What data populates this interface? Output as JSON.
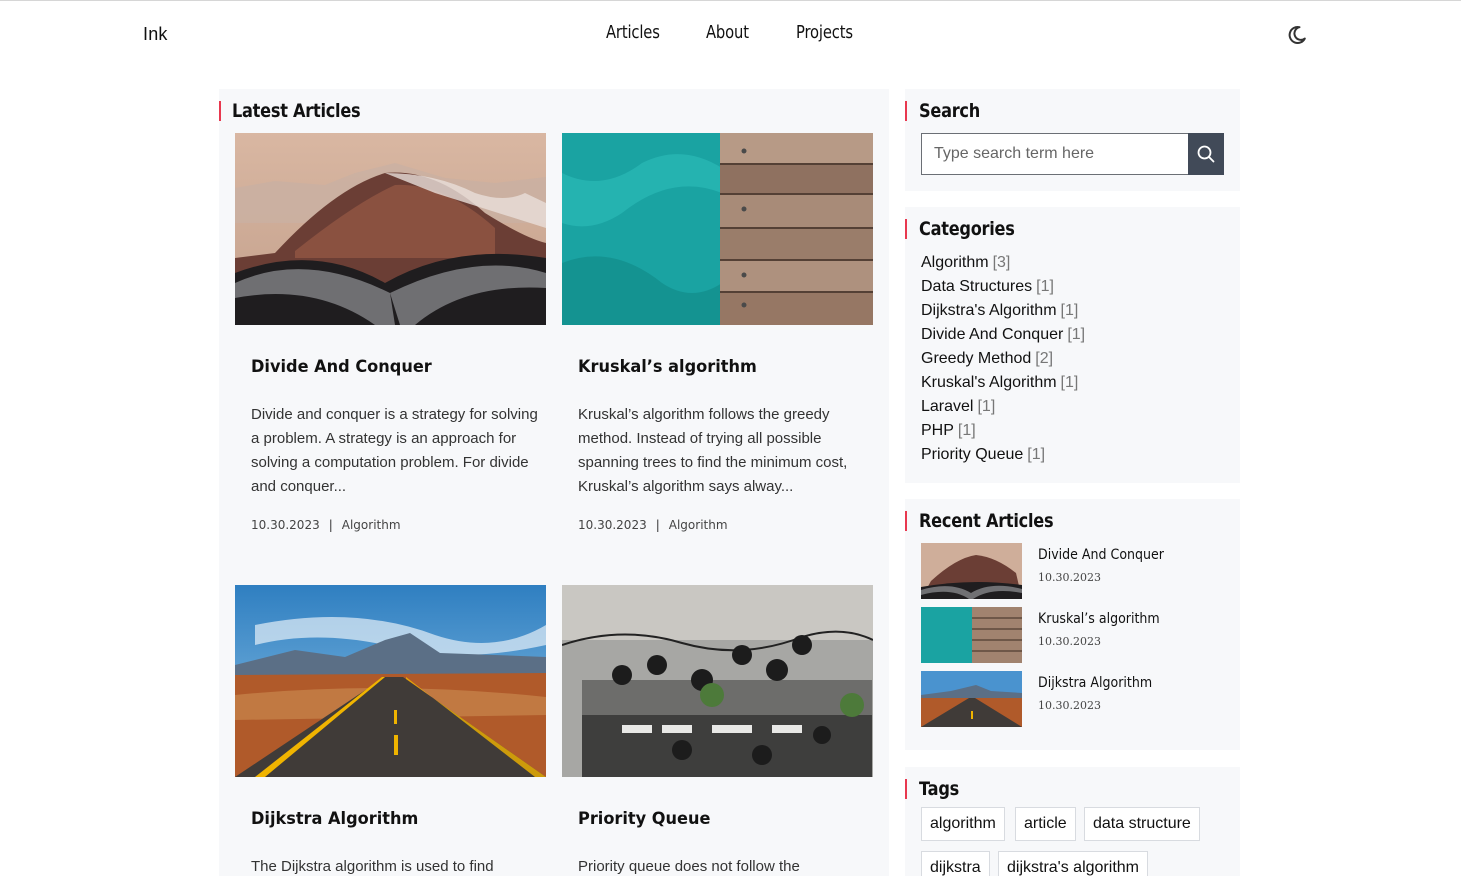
{
  "header": {
    "brand": "Ink",
    "nav": [
      {
        "label": "Articles"
      },
      {
        "label": "About"
      },
      {
        "label": "Projects"
      }
    ],
    "theme_icon": "moon-icon"
  },
  "latest": {
    "title": "Latest Articles",
    "cards": [
      {
        "title": "Divide And Conquer",
        "excerpt": "Divide and conquer is a strategy for solving a problem. A strategy is an approach for solving a computation problem. For divide and conquer...",
        "date": "10.30.2023",
        "category": "Algorithm",
        "image": "misty-mountain-road"
      },
      {
        "title": "Kruskal’s algorithm",
        "excerpt": "Kruskal’s algorithm follows the greedy method. Instead of trying all possible spanning trees to find the minimum cost, Kruskal’s algorithm says alway...",
        "date": "10.30.2023",
        "category": "Algorithm",
        "image": "turquoise-water-dock"
      },
      {
        "title": "Dijkstra Algorithm",
        "excerpt": "The Dijkstra algorithm is used to find",
        "image": "desert-highway"
      },
      {
        "title": "Priority Queue",
        "excerpt": "Priority queue does not follow the",
        "image": "cafe-counter-topdown"
      }
    ]
  },
  "search": {
    "title": "Search",
    "placeholder": "Type search term here",
    "icon": "search-icon"
  },
  "categories": {
    "title": "Categories",
    "items": [
      {
        "name": "Algorithm",
        "count": "[3]"
      },
      {
        "name": "Data Structures",
        "count": "[1]"
      },
      {
        "name": "Dijkstra's Algorithm",
        "count": "[1]"
      },
      {
        "name": "Divide And Conquer",
        "count": "[1]"
      },
      {
        "name": "Greedy Method",
        "count": "[2]"
      },
      {
        "name": "Kruskal's Algorithm",
        "count": "[1]"
      },
      {
        "name": "Laravel",
        "count": "[1]"
      },
      {
        "name": "PHP",
        "count": "[1]"
      },
      {
        "name": "Priority Queue",
        "count": "[1]"
      }
    ]
  },
  "recent": {
    "title": "Recent Articles",
    "items": [
      {
        "title": "Divide And Conquer",
        "date": "10.30.2023"
      },
      {
        "title": "Kruskal’s algorithm",
        "date": "10.30.2023"
      },
      {
        "title": "Dijkstra Algorithm",
        "date": "10.30.2023"
      }
    ]
  },
  "tags": {
    "title": "Tags",
    "items": [
      "algorithm",
      "article",
      "data structure",
      "dijkstra",
      "dijkstra's algorithm"
    ]
  },
  "colors": {
    "accent": "#e8384f",
    "panel_bg": "#f7f8fa",
    "search_button": "#414a58"
  }
}
